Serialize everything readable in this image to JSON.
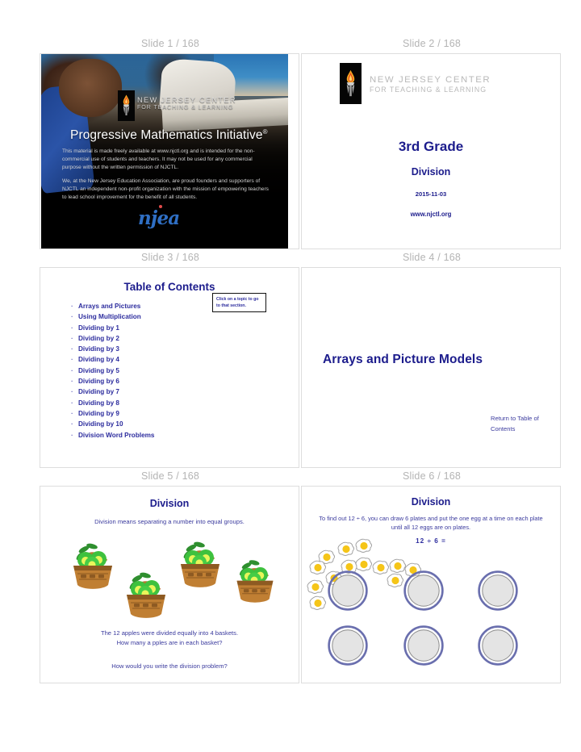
{
  "colors": {
    "slide_label": "#b4b4b4",
    "heading_navy": "#1c1c8c",
    "body_navy": "#3b3b9e",
    "frame_border": "#dddddd",
    "njea_blue": "#2f6fc4",
    "plate_rim": "#6a6fae",
    "plate_fill": "#e4e4e4",
    "egg_yolk": "#f5c518",
    "basket_brown": "#b5762e",
    "apple_green": "#33cc33"
  },
  "slides": [
    {
      "label": "Slide 1 / 168",
      "brand_line1": "NEW JERSEY CENTER",
      "brand_line2": "FOR TEACHING & LEARNING",
      "program_title": "Progressive Mathematics Initiative",
      "program_title_mark": "®",
      "legal_p1": "This material is made freely available at www.njctl.org and is intended for the non-commercial use of students and teachers. It may not be used for any commercial purpose without the written permission of NJCTL.",
      "legal_p2": "We, at the New Jersey Education Association, are proud founders and supporters of NJCTL an independent non-profit organization with the mission of empowering teachers to lead school improvement for the benefit of all students.",
      "sponsor": "njea",
      "logo_icon": "torch-icon"
    },
    {
      "label": "Slide 2 / 168",
      "brand_line1": "NEW JERSEY CENTER",
      "brand_line2": "FOR TEACHING & LEARNING",
      "grade": "3rd Grade",
      "subject": "Division",
      "date": "2015-11-03",
      "url": "www.njctl.org",
      "logo_icon": "torch-icon"
    },
    {
      "label": "Slide 3 / 168",
      "title": "Table of Contents",
      "hint": "Click on a topic to go to that section.",
      "items": [
        "Arrays and Pictures",
        "Using Multiplication",
        "Dividing by 1",
        "Dividing by 2",
        "Dividing by 3",
        "Dividing by 4",
        "Dividing by 5",
        "Dividing by 6",
        "Dividing by 7",
        "Dividing by 8",
        "Dividing by 9",
        "Dividing by 10",
        "Division Word Problems"
      ]
    },
    {
      "label": "Slide 4 / 168",
      "section_title": "Arrays and Picture Models",
      "return_link": "Return to Table of Contents"
    },
    {
      "label": "Slide 5 / 168",
      "title": "Division",
      "lead": "Division means separating a number into equal groups.",
      "question_1": "The 12 apples were divided equally into 4 baskets.",
      "question_2": "How many a  pples are in each basket?",
      "question_3": "How would you write the division problem?",
      "basket_count": 4,
      "apple_total": 12
    },
    {
      "label": "Slide 6 / 168",
      "title": "Division",
      "lead": "To find out 12 ÷ 6, you can draw 6 plates and put the one egg at a time on each plate until all 12 eggs are on plates.",
      "expression": "12 ÷ 6 =",
      "plate_count": 6,
      "egg_count": 12
    }
  ]
}
